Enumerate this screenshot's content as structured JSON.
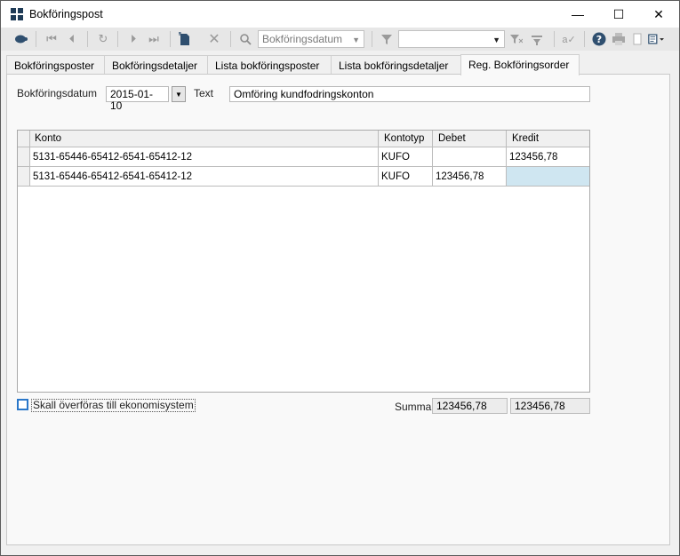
{
  "window": {
    "title": "Bokföringspost",
    "minimize": "—",
    "maximize": "☐",
    "close": "✕"
  },
  "toolbar": {
    "sort_combo_value": "Bokföringsdatum",
    "filter_combo_value": ""
  },
  "tabs": [
    {
      "label": "Bokföringsposter"
    },
    {
      "label": "Bokföringsdetaljer"
    },
    {
      "label": "Lista bokföringsposter"
    },
    {
      "label": "Lista bokföringsdetaljer"
    },
    {
      "label": "Reg. Bokföringsorder",
      "active": true
    }
  ],
  "form": {
    "date_label": "Bokföringsdatum",
    "date_value": "2015-01-10",
    "text_label": "Text",
    "text_value": "Omföring kundfodringskonton"
  },
  "grid": {
    "columns": [
      "Konto",
      "Kontotyp",
      "Debet",
      "Kredit"
    ],
    "rows": [
      {
        "konto": "5131-65446-65412-6541-65412-12",
        "kontotyp": "KUFO",
        "debet": "",
        "kredit": "123456,78"
      },
      {
        "konto": "5131-65446-65412-6541-65412-12",
        "kontotyp": "KUFO",
        "debet": "123456,78",
        "kredit": ""
      }
    ]
  },
  "footer": {
    "checkbox_label": "Skall överföras till ekonomisystem",
    "summa_label": "Summa",
    "summa_debet": "123456,78",
    "summa_kredit": "123456,78"
  },
  "colors": {
    "accent": "#2a77c9",
    "selected_cell": "#cfe6f1"
  }
}
